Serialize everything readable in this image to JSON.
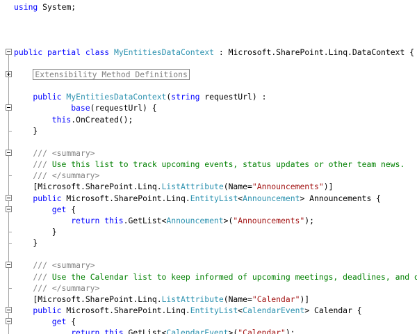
{
  "editor": {
    "lines": [
      {
        "indent": 0,
        "fold": null,
        "tokens": [
          {
            "t": "kw",
            "v": "using"
          },
          {
            "t": "plain",
            "v": " System;"
          }
        ]
      },
      {
        "indent": 0,
        "fold": null,
        "tokens": []
      },
      {
        "indent": 0,
        "fold": null,
        "tokens": []
      },
      {
        "indent": 0,
        "fold": null,
        "tokens": []
      },
      {
        "indent": 0,
        "fold": "open",
        "tokens": [
          {
            "t": "kw",
            "v": "public partial class"
          },
          {
            "t": "plain",
            "v": " "
          },
          {
            "t": "type",
            "v": "MyEntitiesDataContext"
          },
          {
            "t": "plain",
            "v": " : Microsoft.SharePoint.Linq.DataContext {"
          }
        ]
      },
      {
        "indent": 0,
        "fold": null,
        "tokens": []
      },
      {
        "indent": 1,
        "fold": "collapsed",
        "region": true,
        "tokens": [
          {
            "t": "doc",
            "v": "Extensibility Method Definitions"
          }
        ]
      },
      {
        "indent": 0,
        "fold": null,
        "tokens": []
      },
      {
        "indent": 1,
        "fold": null,
        "tokens": [
          {
            "t": "kw",
            "v": "public"
          },
          {
            "t": "plain",
            "v": " "
          },
          {
            "t": "type",
            "v": "MyEntitiesDataContext"
          },
          {
            "t": "plain",
            "v": "("
          },
          {
            "t": "kw",
            "v": "string"
          },
          {
            "t": "plain",
            "v": " requestUrl) :"
          }
        ]
      },
      {
        "indent": 3,
        "fold": "open",
        "tokens": [
          {
            "t": "kw",
            "v": "base"
          },
          {
            "t": "plain",
            "v": "(requestUrl) {"
          }
        ]
      },
      {
        "indent": 2,
        "fold": null,
        "tokens": [
          {
            "t": "kw",
            "v": "this"
          },
          {
            "t": "plain",
            "v": ".OnCreated();"
          }
        ]
      },
      {
        "indent": 1,
        "fold": "end",
        "tokens": [
          {
            "t": "plain",
            "v": "}"
          }
        ]
      },
      {
        "indent": 0,
        "fold": null,
        "tokens": []
      },
      {
        "indent": 1,
        "fold": "open",
        "tokens": [
          {
            "t": "doc",
            "v": "/// <summary>"
          }
        ]
      },
      {
        "indent": 1,
        "fold": null,
        "tokens": [
          {
            "t": "doc",
            "v": "/// "
          },
          {
            "t": "cmt",
            "v": "Use this list to track upcoming events, status updates or other team news."
          }
        ]
      },
      {
        "indent": 1,
        "fold": "end",
        "tokens": [
          {
            "t": "doc",
            "v": "/// </summary>"
          }
        ]
      },
      {
        "indent": 1,
        "fold": null,
        "tokens": [
          {
            "t": "plain",
            "v": "[Microsoft.SharePoint.Linq."
          },
          {
            "t": "type",
            "v": "ListAttribute"
          },
          {
            "t": "plain",
            "v": "(Name="
          },
          {
            "t": "str",
            "v": "\"Announcements\""
          },
          {
            "t": "plain",
            "v": ")]"
          }
        ]
      },
      {
        "indent": 1,
        "fold": "open",
        "tokens": [
          {
            "t": "kw",
            "v": "public"
          },
          {
            "t": "plain",
            "v": " Microsoft.SharePoint.Linq."
          },
          {
            "t": "type",
            "v": "EntityList"
          },
          {
            "t": "plain",
            "v": "<"
          },
          {
            "t": "type",
            "v": "Announcement"
          },
          {
            "t": "plain",
            "v": "> Announcements {"
          }
        ]
      },
      {
        "indent": 2,
        "fold": "open",
        "tokens": [
          {
            "t": "kw",
            "v": "get"
          },
          {
            "t": "plain",
            "v": " {"
          }
        ]
      },
      {
        "indent": 3,
        "fold": null,
        "tokens": [
          {
            "t": "kw",
            "v": "return this"
          },
          {
            "t": "plain",
            "v": ".GetList<"
          },
          {
            "t": "type",
            "v": "Announcement"
          },
          {
            "t": "plain",
            "v": ">("
          },
          {
            "t": "str",
            "v": "\"Announcements\""
          },
          {
            "t": "plain",
            "v": ");"
          }
        ]
      },
      {
        "indent": 2,
        "fold": "end",
        "tokens": [
          {
            "t": "plain",
            "v": "}"
          }
        ]
      },
      {
        "indent": 1,
        "fold": "end",
        "tokens": [
          {
            "t": "plain",
            "v": "}"
          }
        ]
      },
      {
        "indent": 0,
        "fold": null,
        "tokens": []
      },
      {
        "indent": 1,
        "fold": "open",
        "tokens": [
          {
            "t": "doc",
            "v": "/// <summary>"
          }
        ]
      },
      {
        "indent": 1,
        "fold": null,
        "tokens": [
          {
            "t": "doc",
            "v": "/// "
          },
          {
            "t": "cmt",
            "v": "Use the Calendar list to keep informed of upcoming meetings, deadlines, and o"
          }
        ]
      },
      {
        "indent": 1,
        "fold": "end",
        "tokens": [
          {
            "t": "doc",
            "v": "/// </summary>"
          }
        ]
      },
      {
        "indent": 1,
        "fold": null,
        "tokens": [
          {
            "t": "plain",
            "v": "[Microsoft.SharePoint.Linq."
          },
          {
            "t": "type",
            "v": "ListAttribute"
          },
          {
            "t": "plain",
            "v": "(Name="
          },
          {
            "t": "str",
            "v": "\"Calendar\""
          },
          {
            "t": "plain",
            "v": ")]"
          }
        ]
      },
      {
        "indent": 1,
        "fold": "open",
        "tokens": [
          {
            "t": "kw",
            "v": "public"
          },
          {
            "t": "plain",
            "v": " Microsoft.SharePoint.Linq."
          },
          {
            "t": "type",
            "v": "EntityList"
          },
          {
            "t": "plain",
            "v": "<"
          },
          {
            "t": "type",
            "v": "CalendarEvent"
          },
          {
            "t": "plain",
            "v": "> Calendar {"
          }
        ]
      },
      {
        "indent": 2,
        "fold": "open",
        "tokens": [
          {
            "t": "kw",
            "v": "get"
          },
          {
            "t": "plain",
            "v": " {"
          }
        ]
      },
      {
        "indent": 3,
        "fold": null,
        "tokens": [
          {
            "t": "kw",
            "v": "return this"
          },
          {
            "t": "plain",
            "v": ".GetList<"
          },
          {
            "t": "type",
            "v": "CalendarEvent"
          },
          {
            "t": "plain",
            "v": ">("
          },
          {
            "t": "str",
            "v": "\"Calendar\""
          },
          {
            "t": "plain",
            "v": ");"
          }
        ]
      },
      {
        "indent": 2,
        "fold": null,
        "tokens": [
          {
            "t": "plain",
            "v": "}"
          }
        ]
      }
    ]
  },
  "colors": {
    "keyword": "#0000ff",
    "type": "#2b91af",
    "string": "#a31515",
    "comment": "#008000",
    "doc_tag": "#808080",
    "background": "#ffffff"
  }
}
